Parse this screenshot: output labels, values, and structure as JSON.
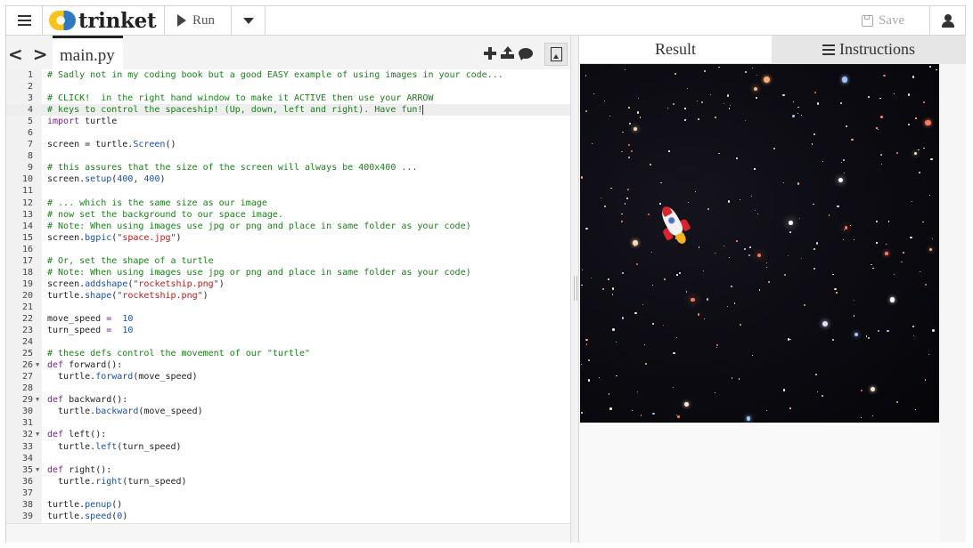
{
  "topbar": {
    "logo_text": "trinket",
    "run_label": "Run",
    "save_label": "Save"
  },
  "editor": {
    "nav_arrows": "< >",
    "file_tab": "main.py",
    "active_line": 4,
    "lines": [
      {
        "n": "1",
        "fold": false,
        "segs": [
          [
            "c",
            "# Sadly not in my coding book but a good EASY example of using images in your code..."
          ]
        ]
      },
      {
        "n": "2",
        "fold": false,
        "segs": []
      },
      {
        "n": "3",
        "fold": false,
        "segs": [
          [
            "c",
            "# CLICK!  in the right hand window to make it ACTIVE then use your ARROW"
          ]
        ]
      },
      {
        "n": "4",
        "fold": false,
        "segs": [
          [
            "c",
            "# keys to control the spaceship! (Up, down, left and right). Have fun!"
          ]
        ]
      },
      {
        "n": "5",
        "fold": false,
        "segs": [
          [
            "k",
            "import"
          ],
          [
            "",
            "turtle"
          ]
        ]
      },
      {
        "n": "6",
        "fold": false,
        "segs": []
      },
      {
        "n": "7",
        "fold": false,
        "segs": [
          [
            "",
            "screen = turtle."
          ],
          [
            "n",
            "Screen"
          ],
          [
            "",
            "()"
          ]
        ]
      },
      {
        "n": "8",
        "fold": false,
        "segs": []
      },
      {
        "n": "9",
        "fold": false,
        "segs": [
          [
            "c",
            "# this assures that the size of the screen will always be 400x400 ..."
          ]
        ]
      },
      {
        "n": "10",
        "fold": false,
        "segs": [
          [
            "",
            "screen."
          ],
          [
            "n",
            "setup"
          ],
          [
            "",
            "("
          ],
          [
            "n",
            "400"
          ],
          [
            "",
            ", "
          ],
          [
            "n",
            "400"
          ],
          [
            "",
            ")"
          ]
        ]
      },
      {
        "n": "11",
        "fold": false,
        "segs": []
      },
      {
        "n": "12",
        "fold": false,
        "segs": [
          [
            "c",
            "# ... which is the same size as our image"
          ]
        ]
      },
      {
        "n": "13",
        "fold": false,
        "segs": [
          [
            "c",
            "# now set the background to our space image."
          ]
        ]
      },
      {
        "n": "14",
        "fold": false,
        "segs": [
          [
            "c",
            "# Note: When using images use jpg or png and place in same folder as your code)"
          ]
        ]
      },
      {
        "n": "15",
        "fold": false,
        "segs": [
          [
            "",
            "screen."
          ],
          [
            "n",
            "bgpic"
          ],
          [
            "",
            "("
          ],
          [
            "s",
            "\"space.jpg\""
          ],
          [
            "",
            ")"
          ]
        ]
      },
      {
        "n": "16",
        "fold": false,
        "segs": []
      },
      {
        "n": "17",
        "fold": false,
        "segs": [
          [
            "c",
            "# Or, set the shape of a turtle"
          ]
        ]
      },
      {
        "n": "18",
        "fold": false,
        "segs": [
          [
            "c",
            "# Note: When using images use jpg or png and place in same folder as your code)"
          ]
        ]
      },
      {
        "n": "19",
        "fold": false,
        "segs": [
          [
            "",
            "screen."
          ],
          [
            "n",
            "addshape"
          ],
          [
            "",
            "("
          ],
          [
            "s",
            "\"rocketship.png\""
          ],
          [
            "",
            ")"
          ]
        ]
      },
      {
        "n": "20",
        "fold": false,
        "segs": [
          [
            "",
            "turtle."
          ],
          [
            "n",
            "shape"
          ],
          [
            "",
            "("
          ],
          [
            "s",
            "\"rocketship.png\""
          ],
          [
            "",
            ")"
          ]
        ]
      },
      {
        "n": "21",
        "fold": false,
        "segs": []
      },
      {
        "n": "22",
        "fold": false,
        "segs": [
          [
            "",
            "move_speed "
          ],
          [
            "k",
            "="
          ],
          [
            "",
            ""
          ],
          [
            "n",
            "10"
          ]
        ]
      },
      {
        "n": "23",
        "fold": false,
        "segs": [
          [
            "",
            "turn_speed "
          ],
          [
            "k",
            "="
          ],
          [
            "",
            ""
          ],
          [
            "n",
            "10"
          ]
        ]
      },
      {
        "n": "24",
        "fold": false,
        "segs": []
      },
      {
        "n": "25",
        "fold": false,
        "segs": [
          [
            "c",
            "# these defs control the movement of our \"turtle\""
          ]
        ]
      },
      {
        "n": "26",
        "fold": true,
        "segs": [
          [
            "k",
            "def"
          ],
          [
            "",
            "forward():"
          ]
        ]
      },
      {
        "n": "27",
        "fold": false,
        "segs": [
          [
            "",
            "  turtle."
          ],
          [
            "n",
            "forward"
          ],
          [
            "",
            "(move_speed)"
          ]
        ]
      },
      {
        "n": "28",
        "fold": false,
        "segs": []
      },
      {
        "n": "29",
        "fold": true,
        "segs": [
          [
            "k",
            "def"
          ],
          [
            "",
            "backward():"
          ]
        ]
      },
      {
        "n": "30",
        "fold": false,
        "segs": [
          [
            "",
            "  turtle."
          ],
          [
            "n",
            "backward"
          ],
          [
            "",
            "(move_speed)"
          ]
        ]
      },
      {
        "n": "31",
        "fold": false,
        "segs": []
      },
      {
        "n": "32",
        "fold": true,
        "segs": [
          [
            "k",
            "def"
          ],
          [
            "",
            "left():"
          ]
        ]
      },
      {
        "n": "33",
        "fold": false,
        "segs": [
          [
            "",
            "  turtle."
          ],
          [
            "n",
            "left"
          ],
          [
            "",
            "(turn_speed)"
          ]
        ]
      },
      {
        "n": "34",
        "fold": false,
        "segs": []
      },
      {
        "n": "35",
        "fold": true,
        "segs": [
          [
            "k",
            "def"
          ],
          [
            "",
            "right():"
          ]
        ]
      },
      {
        "n": "36",
        "fold": false,
        "segs": [
          [
            "",
            "  turtle."
          ],
          [
            "n",
            "right"
          ],
          [
            "",
            "(turn_speed)"
          ]
        ]
      },
      {
        "n": "37",
        "fold": false,
        "segs": []
      },
      {
        "n": "38",
        "fold": false,
        "segs": [
          [
            "",
            "turtle."
          ],
          [
            "n",
            "penup"
          ],
          [
            "",
            "()"
          ]
        ]
      },
      {
        "n": "39",
        "fold": false,
        "segs": [
          [
            "",
            "turtle."
          ],
          [
            "n",
            "speed"
          ],
          [
            "",
            "("
          ],
          [
            "n",
            "0"
          ],
          [
            "",
            ")"
          ]
        ]
      }
    ]
  },
  "tabs": {
    "result": "Result",
    "instructions": "Instructions"
  },
  "icons": {
    "menu": "hamburger-icon",
    "logo": "trinket-logo-icon",
    "run": "play-icon",
    "dropdown": "caret-down-icon",
    "save": "floppy-disk-icon",
    "user": "user-icon",
    "add_file": "plus-icon",
    "upload": "upload-icon",
    "comment": "comment-icon",
    "images": "image-file-icon",
    "instructions": "list-icon",
    "rocket": "rocketship-turtle-icon"
  },
  "colors": {
    "comment": "#1a7f1a",
    "keyword": "#7a1f8a",
    "string": "#b21e1e",
    "builtin": "#1e4fa6",
    "space_bg": "#0a0a10",
    "rocket_red": "#d9242b"
  }
}
